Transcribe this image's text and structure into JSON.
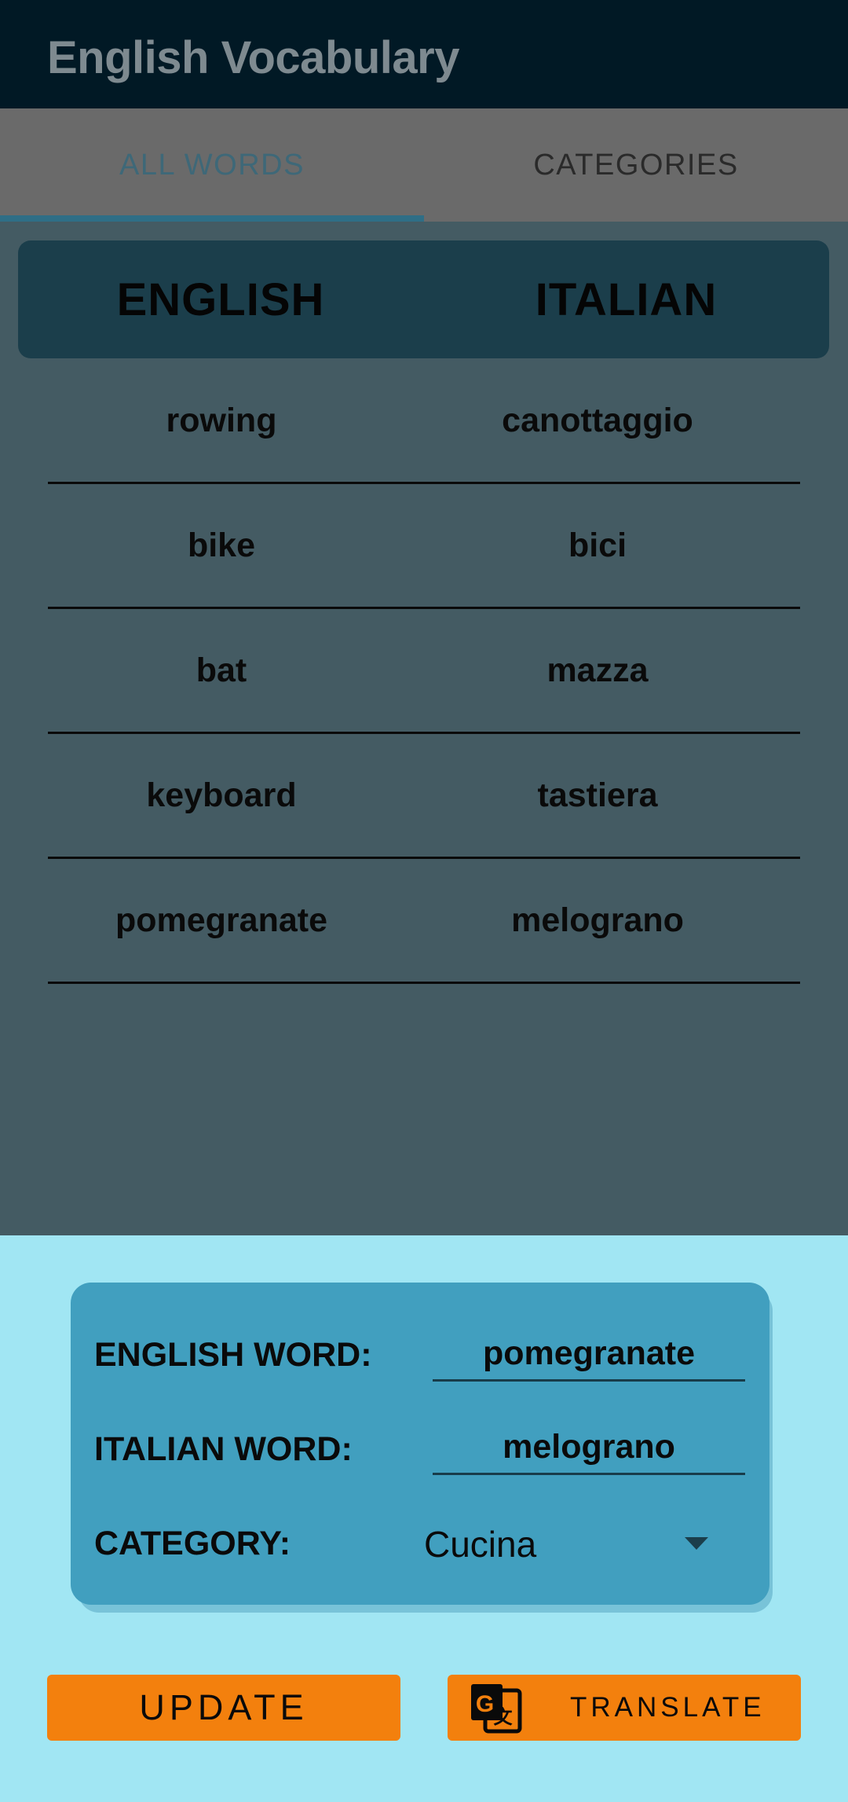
{
  "appbar": {
    "title": "English Vocabulary"
  },
  "tabs": [
    {
      "label": "ALL WORDS",
      "selected": true
    },
    {
      "label": "CATEGORIES",
      "selected": false
    }
  ],
  "table": {
    "headers": {
      "english": "ENGLISH",
      "italian": "ITALIAN"
    },
    "rows": [
      {
        "english": "rowing",
        "italian": "canottaggio"
      },
      {
        "english": "bike",
        "italian": "bici"
      },
      {
        "english": "bat",
        "italian": "mazza"
      },
      {
        "english": "keyboard",
        "italian": "tastiera"
      },
      {
        "english": "pomegranate",
        "italian": "melograno"
      }
    ]
  },
  "form": {
    "english_label": "ENGLISH WORD:",
    "english_value": "pomegranate",
    "italian_label": "ITALIAN WORD:",
    "italian_value": "melograno",
    "category_label": "CATEGORY:",
    "category_value": "Cucina"
  },
  "buttons": {
    "update_label": "UPDATE",
    "translate_label": "TRANSLATE",
    "translate_icon": "google-translate-icon"
  },
  "colors": {
    "appbar": "#011925",
    "accent_orange": "#f3800d",
    "panel_blue": "#a1e6f3",
    "card_blue": "#419fbf",
    "header_dark": "#1b3e4b"
  }
}
